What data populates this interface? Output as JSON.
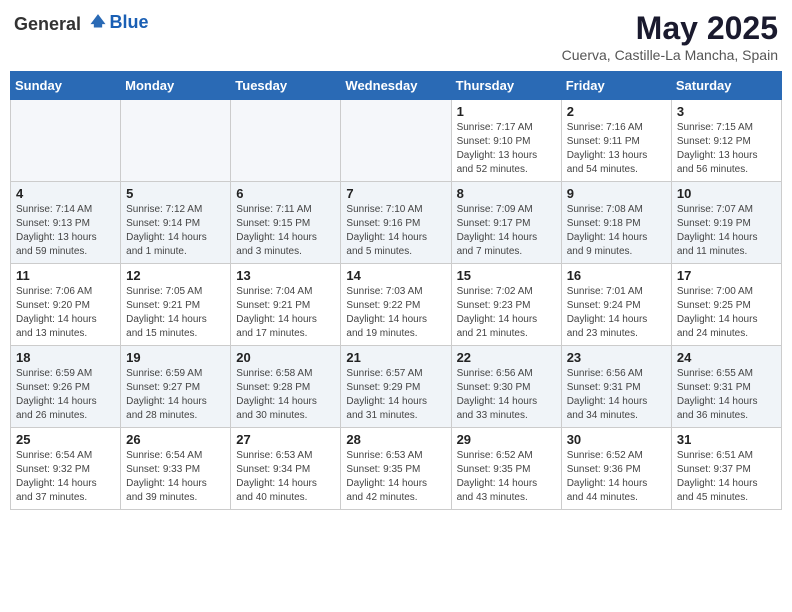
{
  "header": {
    "logo_general": "General",
    "logo_blue": "Blue",
    "title": "May 2025",
    "subtitle": "Cuerva, Castille-La Mancha, Spain"
  },
  "days_of_week": [
    "Sunday",
    "Monday",
    "Tuesday",
    "Wednesday",
    "Thursday",
    "Friday",
    "Saturday"
  ],
  "weeks": [
    [
      {
        "day": "",
        "info": ""
      },
      {
        "day": "",
        "info": ""
      },
      {
        "day": "",
        "info": ""
      },
      {
        "day": "",
        "info": ""
      },
      {
        "day": "1",
        "info": "Sunrise: 7:17 AM\nSunset: 9:10 PM\nDaylight: 13 hours\nand 52 minutes."
      },
      {
        "day": "2",
        "info": "Sunrise: 7:16 AM\nSunset: 9:11 PM\nDaylight: 13 hours\nand 54 minutes."
      },
      {
        "day": "3",
        "info": "Sunrise: 7:15 AM\nSunset: 9:12 PM\nDaylight: 13 hours\nand 56 minutes."
      }
    ],
    [
      {
        "day": "4",
        "info": "Sunrise: 7:14 AM\nSunset: 9:13 PM\nDaylight: 13 hours\nand 59 minutes."
      },
      {
        "day": "5",
        "info": "Sunrise: 7:12 AM\nSunset: 9:14 PM\nDaylight: 14 hours\nand 1 minute."
      },
      {
        "day": "6",
        "info": "Sunrise: 7:11 AM\nSunset: 9:15 PM\nDaylight: 14 hours\nand 3 minutes."
      },
      {
        "day": "7",
        "info": "Sunrise: 7:10 AM\nSunset: 9:16 PM\nDaylight: 14 hours\nand 5 minutes."
      },
      {
        "day": "8",
        "info": "Sunrise: 7:09 AM\nSunset: 9:17 PM\nDaylight: 14 hours\nand 7 minutes."
      },
      {
        "day": "9",
        "info": "Sunrise: 7:08 AM\nSunset: 9:18 PM\nDaylight: 14 hours\nand 9 minutes."
      },
      {
        "day": "10",
        "info": "Sunrise: 7:07 AM\nSunset: 9:19 PM\nDaylight: 14 hours\nand 11 minutes."
      }
    ],
    [
      {
        "day": "11",
        "info": "Sunrise: 7:06 AM\nSunset: 9:20 PM\nDaylight: 14 hours\nand 13 minutes."
      },
      {
        "day": "12",
        "info": "Sunrise: 7:05 AM\nSunset: 9:21 PM\nDaylight: 14 hours\nand 15 minutes."
      },
      {
        "day": "13",
        "info": "Sunrise: 7:04 AM\nSunset: 9:21 PM\nDaylight: 14 hours\nand 17 minutes."
      },
      {
        "day": "14",
        "info": "Sunrise: 7:03 AM\nSunset: 9:22 PM\nDaylight: 14 hours\nand 19 minutes."
      },
      {
        "day": "15",
        "info": "Sunrise: 7:02 AM\nSunset: 9:23 PM\nDaylight: 14 hours\nand 21 minutes."
      },
      {
        "day": "16",
        "info": "Sunrise: 7:01 AM\nSunset: 9:24 PM\nDaylight: 14 hours\nand 23 minutes."
      },
      {
        "day": "17",
        "info": "Sunrise: 7:00 AM\nSunset: 9:25 PM\nDaylight: 14 hours\nand 24 minutes."
      }
    ],
    [
      {
        "day": "18",
        "info": "Sunrise: 6:59 AM\nSunset: 9:26 PM\nDaylight: 14 hours\nand 26 minutes."
      },
      {
        "day": "19",
        "info": "Sunrise: 6:59 AM\nSunset: 9:27 PM\nDaylight: 14 hours\nand 28 minutes."
      },
      {
        "day": "20",
        "info": "Sunrise: 6:58 AM\nSunset: 9:28 PM\nDaylight: 14 hours\nand 30 minutes."
      },
      {
        "day": "21",
        "info": "Sunrise: 6:57 AM\nSunset: 9:29 PM\nDaylight: 14 hours\nand 31 minutes."
      },
      {
        "day": "22",
        "info": "Sunrise: 6:56 AM\nSunset: 9:30 PM\nDaylight: 14 hours\nand 33 minutes."
      },
      {
        "day": "23",
        "info": "Sunrise: 6:56 AM\nSunset: 9:31 PM\nDaylight: 14 hours\nand 34 minutes."
      },
      {
        "day": "24",
        "info": "Sunrise: 6:55 AM\nSunset: 9:31 PM\nDaylight: 14 hours\nand 36 minutes."
      }
    ],
    [
      {
        "day": "25",
        "info": "Sunrise: 6:54 AM\nSunset: 9:32 PM\nDaylight: 14 hours\nand 37 minutes."
      },
      {
        "day": "26",
        "info": "Sunrise: 6:54 AM\nSunset: 9:33 PM\nDaylight: 14 hours\nand 39 minutes."
      },
      {
        "day": "27",
        "info": "Sunrise: 6:53 AM\nSunset: 9:34 PM\nDaylight: 14 hours\nand 40 minutes."
      },
      {
        "day": "28",
        "info": "Sunrise: 6:53 AM\nSunset: 9:35 PM\nDaylight: 14 hours\nand 42 minutes."
      },
      {
        "day": "29",
        "info": "Sunrise: 6:52 AM\nSunset: 9:35 PM\nDaylight: 14 hours\nand 43 minutes."
      },
      {
        "day": "30",
        "info": "Sunrise: 6:52 AM\nSunset: 9:36 PM\nDaylight: 14 hours\nand 44 minutes."
      },
      {
        "day": "31",
        "info": "Sunrise: 6:51 AM\nSunset: 9:37 PM\nDaylight: 14 hours\nand 45 minutes."
      }
    ]
  ]
}
